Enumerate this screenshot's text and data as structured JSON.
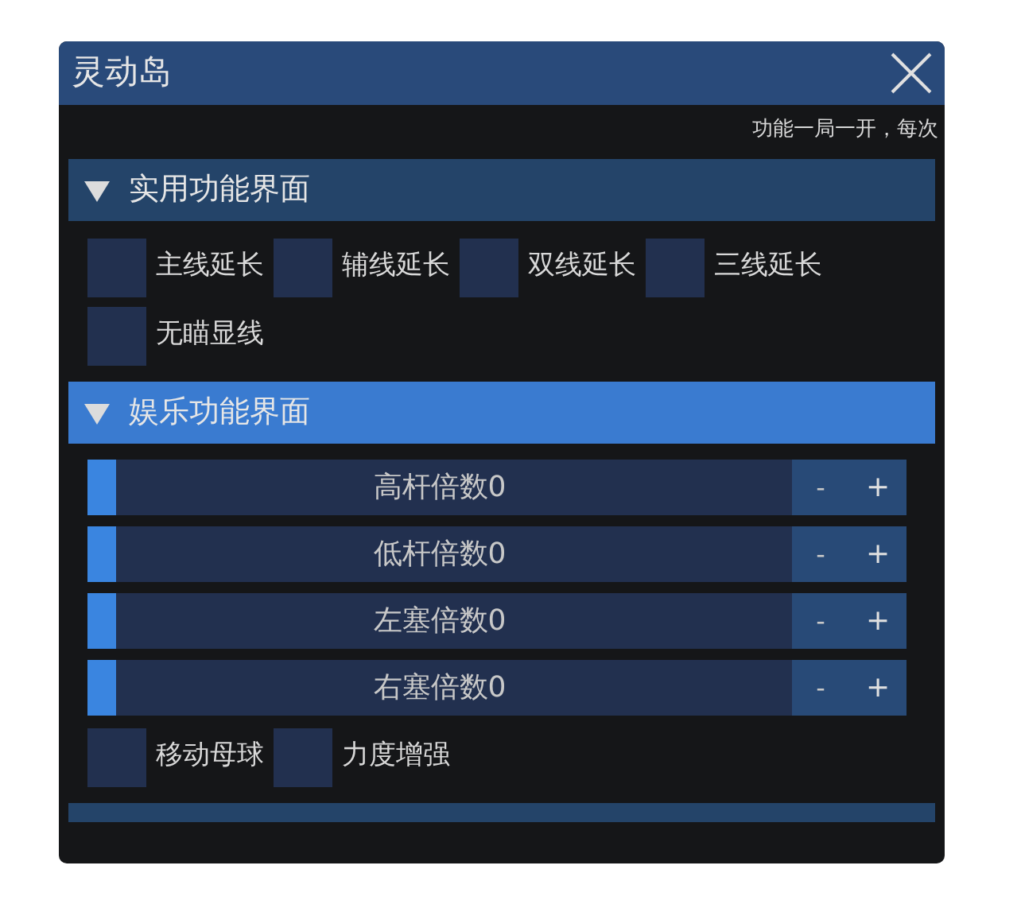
{
  "window": {
    "title": "灵动岛"
  },
  "note": "功能一局一开，每次",
  "sections": [
    {
      "title": "实用功能界面",
      "expanded": true,
      "highlighted": false,
      "items": [
        {
          "kind": "checkbox",
          "label": "主线延长",
          "checked": false
        },
        {
          "kind": "checkbox",
          "label": "辅线延长",
          "checked": false
        },
        {
          "kind": "checkbox",
          "label": "双线延长",
          "checked": false
        },
        {
          "kind": "checkbox",
          "label": "三线延长",
          "checked": false
        },
        {
          "kind": "checkbox",
          "label": "无瞄显线",
          "checked": false
        }
      ]
    },
    {
      "title": "娱乐功能界面",
      "expanded": true,
      "highlighted": true,
      "items": [
        {
          "kind": "slider",
          "label": "高杆倍数0",
          "level": 0,
          "minus": "-",
          "plus": "+"
        },
        {
          "kind": "slider",
          "label": "低杆倍数0",
          "level": 0,
          "minus": "-",
          "plus": "+"
        },
        {
          "kind": "slider",
          "label": "左塞倍数0",
          "level": 0,
          "minus": "-",
          "plus": "+"
        },
        {
          "kind": "slider",
          "label": "右塞倍数0",
          "level": 0,
          "minus": "-",
          "plus": "+"
        },
        {
          "kind": "checkbox",
          "label": "移动母球",
          "checked": false
        },
        {
          "kind": "checkbox",
          "label": "力度增强",
          "checked": false
        }
      ]
    }
  ]
}
